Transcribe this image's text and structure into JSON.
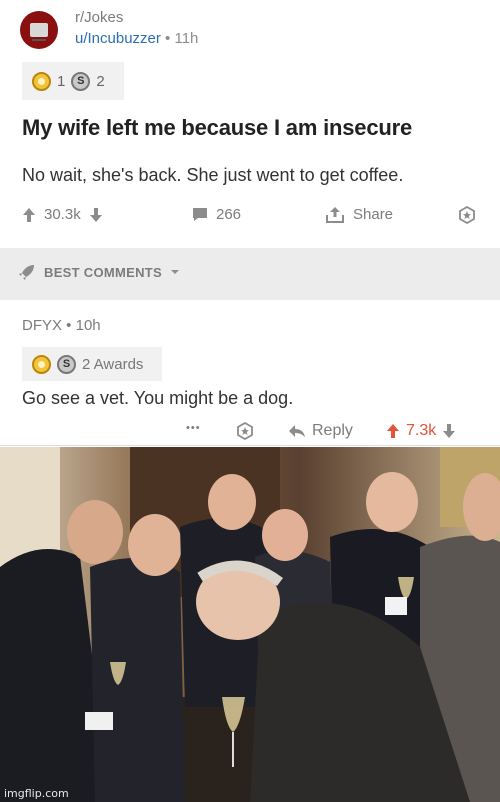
{
  "post": {
    "subreddit": "r/Jokes",
    "username": "u/Incubuzzer",
    "separator": " • ",
    "time": "11h",
    "awards": {
      "gold_count": "1",
      "silver_count": "2"
    },
    "title": "My wife left me because I am insecure",
    "body": "No wait, she's back. She just went to get coffee.",
    "votes": "30.3k",
    "comments": "266",
    "share_label": "Share"
  },
  "best_comments": {
    "label": "BEST COMMENTS"
  },
  "comment": {
    "author": "DFYX",
    "separator": " • ",
    "time": "10h",
    "awards_label": "2 Awards",
    "text": "Go see a vet. You might be a dog.",
    "more": "•••",
    "reply_label": "Reply",
    "votes": "7.3k",
    "votes_color": "#e2533a"
  },
  "meme": {
    "description_icon": "laughing-men-photo",
    "watermark": "imgflip.com"
  }
}
